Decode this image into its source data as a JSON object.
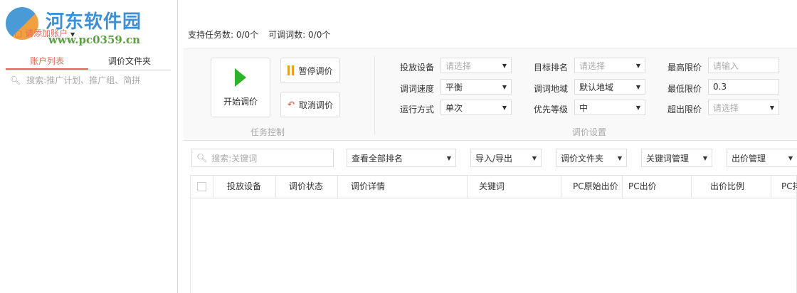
{
  "sidebar": {
    "logo_text": "河东软件园",
    "logo_url": "www.pc0359.cn",
    "add_account": "请添加账户",
    "tabs": [
      "账户列表",
      "调价文件夹"
    ],
    "search_placeholder": "搜索:推广计划、推广组、简拼"
  },
  "stats": {
    "tasks": "支持任务数: 0/0个",
    "words": "可调词数: 0/0个"
  },
  "task_control": {
    "start": "开始调价",
    "pause": "暂停调价",
    "cancel": "取消调价",
    "label": "任务控制"
  },
  "settings": {
    "label": "调价设置",
    "fields": [
      {
        "label": "投放设备",
        "value": "请选择",
        "placeholder": true
      },
      {
        "label": "调词速度",
        "value": "平衡"
      },
      {
        "label": "运行方式",
        "value": "单次"
      },
      {
        "label": "目标排名",
        "value": "请选择",
        "placeholder": true
      },
      {
        "label": "调词地域",
        "value": "默认地域"
      },
      {
        "label": "优先等级",
        "value": "中"
      },
      {
        "label": "最高限价",
        "value": "请输入",
        "placeholder": true
      },
      {
        "label": "最低限价",
        "value": "0.3"
      },
      {
        "label": "超出限价",
        "value": "请选择",
        "placeholder": true
      }
    ]
  },
  "toolbar": {
    "search_placeholder": "搜索:关键词",
    "rank": "查看全部排名",
    "import_export": "导入/导出",
    "folder": "调价文件夹",
    "keyword_mgmt": "关键词管理",
    "bid_mgmt": "出价管理"
  },
  "table": {
    "columns": [
      "投放设备",
      "调价状态",
      "调价详情",
      "关键词",
      "PC原始出价",
      "PC出价",
      "出价比例",
      "PC排"
    ]
  }
}
